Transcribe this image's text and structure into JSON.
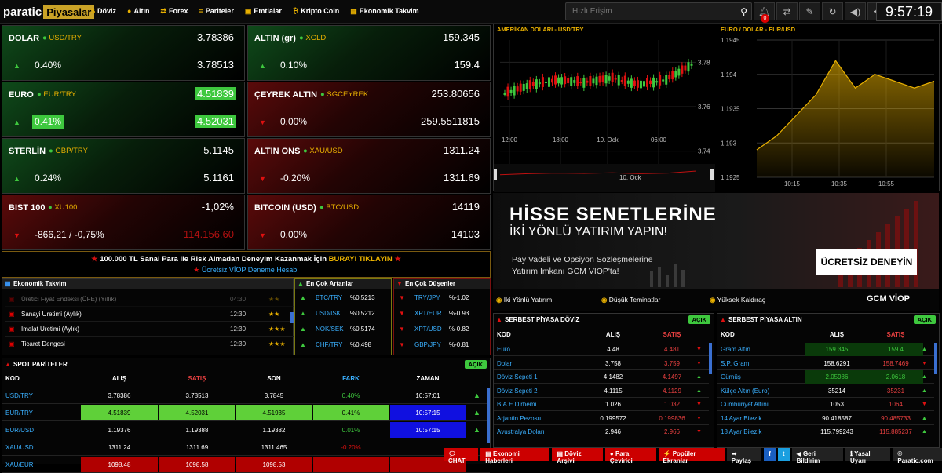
{
  "colors": {
    "up": "#3ec83e",
    "down": "#e01010",
    "accent": "#e8b000"
  },
  "header": {
    "logo_main": "paratic",
    "logo_sub": "Piyasalar",
    "nav": [
      "Döviz",
      "Altın",
      "Forex",
      "Pariteler",
      "Emtialar",
      "Kripto Coin",
      "Ekonomik Takvim"
    ],
    "search_placeholder": "Hızlı Erişim",
    "notif_count": "0",
    "clock": "9:57:19",
    "icons": [
      "bell-icon",
      "swap-icon",
      "pencil-icon",
      "refresh-icon",
      "volume-icon",
      "move-icon",
      "user-icon"
    ]
  },
  "tiles": [
    {
      "name": "DOLAR",
      "sym": "USD/TRY",
      "v1": "3.78386",
      "v2": "3.78513",
      "pct": "0.40%",
      "dir": "up"
    },
    {
      "name": "ALTIN (gr)",
      "sym": "XGLD",
      "v1": "159.345",
      "v2": "159.4",
      "pct": "0.10%",
      "dir": "up"
    },
    {
      "name": "EURO",
      "sym": "EUR/TRY",
      "v1": "4.51839",
      "v2": "4.52031",
      "pct": "0.41%",
      "dir": "up"
    },
    {
      "name": "ÇEYREK ALTIN",
      "sym": "SGCEYREK",
      "v1": "253.80656",
      "v2": "259.5511815",
      "pct": "0.00%",
      "dir": "down"
    },
    {
      "name": "STERLİN",
      "sym": "GBP/TRY",
      "v1": "5.1145",
      "v2": "5.1161",
      "pct": "0.24%",
      "dir": "up"
    },
    {
      "name": "ALTIN ONS",
      "sym": "XAU/USD",
      "v1": "1311.24",
      "v2": "1311.69",
      "pct": "-0.20%",
      "dir": "down"
    },
    {
      "name": "BIST 100",
      "sym": "XU100",
      "v1": "-1,02%",
      "v2": "114.156,60",
      "pct": "-866,21 / -0,75%",
      "dir": "down"
    },
    {
      "name": "BITCOIN (USD)",
      "sym": "BTC/USD",
      "v1": "14119",
      "v2": "14103",
      "pct": "0.00%",
      "dir": "down"
    }
  ],
  "promo": {
    "line1a": "100.000 TL Sanal Para ile Risk Almadan Deneyim Kazanmak İçin",
    "line1b": "BURAYI TIKLAYIN",
    "line2": "Ücretsiz VİOP Deneme Hesabı"
  },
  "calendar": {
    "title": "Ekonomik Takvim",
    "events": [
      {
        "name": "Üretici Fiyat Endeksi (ÜFE) (Yıllık)",
        "time": "04:30",
        "stars": "★★"
      },
      {
        "name": "Sanayi Üretimi (Aylık)",
        "time": "12:30",
        "stars": "★★"
      },
      {
        "name": "İmalat Üretimi (Aylık)",
        "time": "12:30",
        "stars": "★★★"
      },
      {
        "name": "Ticaret Dengesi",
        "time": "12:30",
        "stars": "★★★"
      }
    ]
  },
  "gainers": {
    "title": "En Çok Artanlar",
    "items": [
      {
        "sym": "BTC/TRY",
        "pct": "%0.5213"
      },
      {
        "sym": "USD/ISK",
        "pct": "%0.5212"
      },
      {
        "sym": "NOK/SEK",
        "pct": "%0.5174"
      },
      {
        "sym": "CHF/TRY",
        "pct": "%0.498"
      }
    ]
  },
  "losers": {
    "title": "En Çok Düşenler",
    "items": [
      {
        "sym": "TRY/JPY",
        "pct": "%-1.02"
      },
      {
        "sym": "XPT/EUR",
        "pct": "%-0.93"
      },
      {
        "sym": "XPT/USD",
        "pct": "%-0.82"
      },
      {
        "sym": "GBP/JPY",
        "pct": "%-0.81"
      }
    ]
  },
  "spot": {
    "title": "SPOT PARİTELER",
    "open": "AÇIK",
    "headers": [
      "KOD",
      "ALIŞ",
      "SATIŞ",
      "SON",
      "FARK",
      "ZAMAN"
    ],
    "rows": [
      {
        "kod": "USD/TRY",
        "alis": "3.78386",
        "satis": "3.78513",
        "son": "3.7845",
        "fark": "0.40%",
        "zaman": "10:57:01",
        "hl": ""
      },
      {
        "kod": "EUR/TRY",
        "alis": "4.51839",
        "satis": "4.52031",
        "son": "4.51935",
        "fark": "0.41%",
        "zaman": "10:57:15",
        "hl": "green"
      },
      {
        "kod": "EUR/USD",
        "alis": "1.19376",
        "satis": "1.19388",
        "son": "1.19382",
        "fark": "0.01%",
        "zaman": "10:57:15",
        "hl": "blue"
      },
      {
        "kod": "XAU/USD",
        "alis": "1311.24",
        "satis": "1311.69",
        "son": "1311.465",
        "fark": "-0.20%",
        "zaman": "",
        "hl": ""
      },
      {
        "kod": "XAU/EUR",
        "alis": "1098.48",
        "satis": "1098.58",
        "son": "1098.53",
        "fark": "",
        "zaman": "",
        "hl": "red"
      }
    ]
  },
  "chart1": {
    "title": "AMERİKAN DOLARI - USD/TRY",
    "xticks": [
      "12:00",
      "18:00",
      "10. Ock",
      "06:00"
    ],
    "yticks": [
      "3.78",
      "3.76",
      "3.74"
    ],
    "nav_label": "10. Ock"
  },
  "chart2": {
    "title": "EURO / DOLAR - EUR/USD",
    "xticks": [
      "10:15",
      "10:35",
      "10:55"
    ],
    "yticks": [
      "1.1945",
      "1.194",
      "1.1935",
      "1.193",
      "1.1925"
    ]
  },
  "chart_data": [
    {
      "type": "line",
      "title": "EURO / DOLAR - EUR/USD",
      "x": [
        "10:15",
        "10:20",
        "10:25",
        "10:30",
        "10:35",
        "10:40",
        "10:45",
        "10:50",
        "10:55",
        "11:00"
      ],
      "values": [
        1.1929,
        1.1931,
        1.1934,
        1.1937,
        1.1942,
        1.1938,
        1.194,
        1.1939,
        1.1938,
        1.1939
      ],
      "ylim": [
        1.1925,
        1.1945
      ]
    },
    {
      "type": "line",
      "title": "AMERİKAN DOLARI - USD/TRY",
      "x": [
        "12:00",
        "15:00",
        "18:00",
        "21:00",
        "10. Ock",
        "03:00",
        "06:00",
        "09:00"
      ],
      "values": [
        3.766,
        3.77,
        3.772,
        3.771,
        3.773,
        3.77,
        3.772,
        3.779
      ],
      "ylim": [
        3.73,
        3.79
      ]
    }
  ],
  "ad": {
    "h1": "HİSSE SENETLERİNE",
    "h2": "İKİ YÖNLÜ YATIRIM YAPIN!",
    "p1": "Pay Vadeli ve Opsiyon Sözleşmelerine",
    "p2": "Yatırım İmkanı GCM VİOP'ta!",
    "cta": "ÜCRETSİZ DENEYİN",
    "f1": "İki Yönlü Yatırım",
    "f2": "Düşük Teminatlar",
    "f3": "Yüksek Kaldıraç",
    "brand": "GCM VİOP"
  },
  "doviz": {
    "title": "SERBEST PİYASA DÖVİZ",
    "open": "AÇIK",
    "headers": [
      "KOD",
      "ALIŞ",
      "SATIŞ"
    ],
    "rows": [
      {
        "kod": "Euro",
        "alis": "4.48",
        "satis": "4.481"
      },
      {
        "kod": "Dolar",
        "alis": "3.758",
        "satis": "3.759"
      },
      {
        "kod": "Döviz Sepeti 1",
        "alis": "4.1482",
        "satis": "4.1497"
      },
      {
        "kod": "Döviz Sepeti 2",
        "alis": "4.1115",
        "satis": "4.1129"
      },
      {
        "kod": "B.A.E Dirhemi",
        "alis": "1.026",
        "satis": "1.032"
      },
      {
        "kod": "Arjantin Pezosu",
        "alis": "0.199572",
        "satis": "0.199836"
      },
      {
        "kod": "Avustralya Doları",
        "alis": "2.946",
        "satis": "2.966"
      }
    ]
  },
  "altin": {
    "title": "SERBEST PİYASA ALTIN",
    "open": "AÇIK",
    "headers": [
      "KOD",
      "ALIŞ",
      "SATIŞ"
    ],
    "rows": [
      {
        "kod": "Gram Altın",
        "alis": "159.345",
        "satis": "159.4"
      },
      {
        "kod": "S.P. Gram",
        "alis": "158.6291",
        "satis": "158.7469"
      },
      {
        "kod": "Gümüş",
        "alis": "2.05986",
        "satis": "2.0618"
      },
      {
        "kod": "Külçe Altın (Euro)",
        "alis": "35214",
        "satis": "35231"
      },
      {
        "kod": "Cumhuriyet Altını",
        "alis": "1053",
        "satis": "1064"
      },
      {
        "kod": "14 Ayar Bilezik",
        "alis": "90.418587",
        "satis": "90.485733"
      },
      {
        "kod": "18 Ayar Bilezik",
        "alis": "115.799243",
        "satis": "115.885237"
      }
    ]
  },
  "footer": [
    "CHAT",
    "Ekonomi Haberleri",
    "Döviz Arşivi",
    "Para Çevirici",
    "Popüler Ekranlar",
    "Paylaş",
    "f",
    "t",
    "Geri Bildirim",
    "Yasal Uyarı",
    "Paratic.com"
  ]
}
